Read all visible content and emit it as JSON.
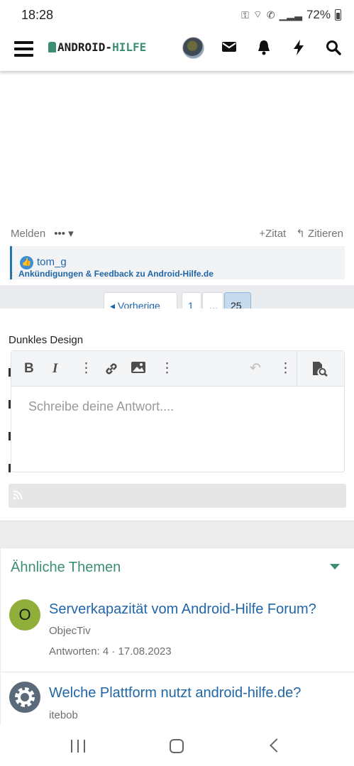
{
  "status": {
    "time": "18:28",
    "battery": "72%"
  },
  "header": {
    "logo_left": "ANDROID-",
    "logo_right": "HILFE"
  },
  "post": {
    "report_label": "Melden",
    "more_label": "•••",
    "quote_label": "Zitat",
    "cite_label": "Zitieren",
    "reaction_user": "tom_g",
    "breadcrumb": "Ankündigungen & Feedback zu Android-Hilfe.de"
  },
  "pagination": {
    "prev_label": "◂ Vorherige",
    "pages": [
      "1",
      "…",
      "25"
    ],
    "active": "25"
  },
  "style_option": "Dunkles Design",
  "editor": {
    "placeholder": "Schreibe deine Antwort...."
  },
  "similar": {
    "heading": "Ähnliche Themen",
    "threads": [
      {
        "title": "Serverkapazität vom Android-Hilfe Forum?",
        "author": "ObjecTiv",
        "meta": "Antworten: 4 · 17.08.2023",
        "avatar_letter": "O",
        "avatar_color": "#8fae3a"
      },
      {
        "title": "Welche Plattform nutzt android-hilfe.de?",
        "author": "itebob",
        "avatar_color": "#5a6a7a"
      }
    ]
  },
  "colors": {
    "brand_green": "#3d8f72",
    "link_blue": "#2166a6"
  }
}
